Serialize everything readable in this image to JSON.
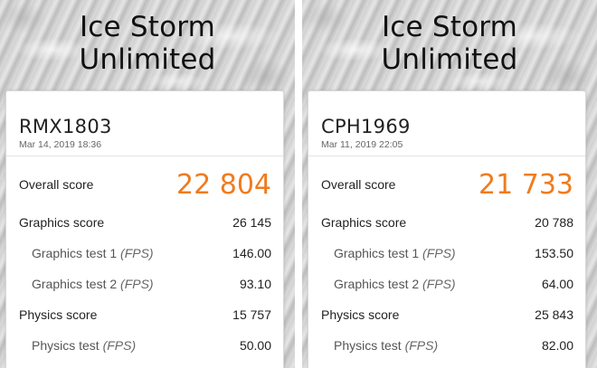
{
  "panels": [
    {
      "title_line1": "Ice Storm",
      "title_line2": "Unlimited",
      "device": "RMX1803",
      "date": "Mar 14, 2019 18:36",
      "overall_label": "Overall score",
      "overall_value": "22 804",
      "graphics_label": "Graphics score",
      "graphics_value": "26 145",
      "gt1_label": "Graphics test 1",
      "gt1_unit": "(FPS)",
      "gt1_value": "146.00",
      "gt2_label": "Graphics test 2",
      "gt2_unit": "(FPS)",
      "gt2_value": "93.10",
      "physics_label": "Physics score",
      "physics_value": "15 757",
      "pt_label": "Physics test",
      "pt_unit": "(FPS)",
      "pt_value": "50.00"
    },
    {
      "title_line1": "Ice Storm",
      "title_line2": "Unlimited",
      "device": "CPH1969",
      "date": "Mar 11, 2019 22:05",
      "overall_label": "Overall score",
      "overall_value": "21 733",
      "graphics_label": "Graphics score",
      "graphics_value": "20 788",
      "gt1_label": "Graphics test 1",
      "gt1_unit": "(FPS)",
      "gt1_value": "153.50",
      "gt2_label": "Graphics test 2",
      "gt2_unit": "(FPS)",
      "gt2_value": "64.00",
      "physics_label": "Physics score",
      "physics_value": "25 843",
      "pt_label": "Physics test",
      "pt_unit": "(FPS)",
      "pt_value": "82.00"
    }
  ],
  "colors": {
    "accent": "#f07b1d",
    "text": "#222222",
    "muted": "#666666"
  }
}
